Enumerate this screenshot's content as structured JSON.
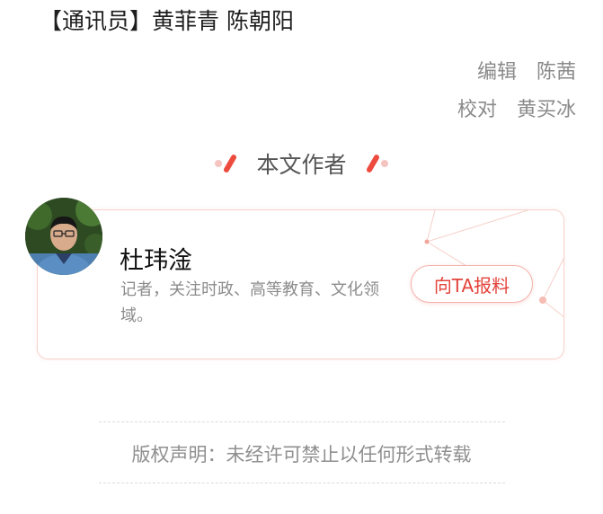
{
  "correspondent": "【通讯员】黄菲青 陈朝阳",
  "editor": {
    "label": "编辑",
    "name": "陈茜"
  },
  "proofreader": {
    "label": "校对",
    "name": "黄买冰"
  },
  "section_title": "本文作者",
  "author": {
    "name": "杜玮淦",
    "bio": "记者，关注时政、高等教育、文化领域。",
    "report_button": "向TA报料"
  },
  "copyright": "版权声明：未经许可禁止以任何形式转载",
  "colors": {
    "accent": "#e3433a",
    "deco_dot": "#f6c4c0",
    "deco_slash": "#ee4b3f"
  }
}
